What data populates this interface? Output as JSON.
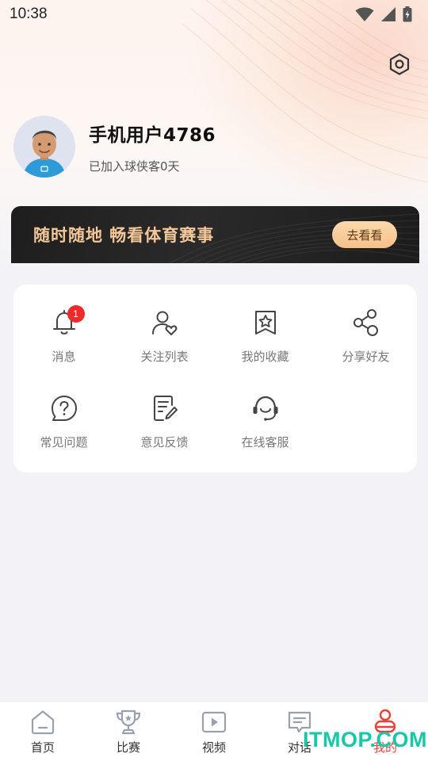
{
  "status_bar": {
    "time": "10:38"
  },
  "profile": {
    "username": "手机用户4786",
    "joined_text": "已加入球侠客0天"
  },
  "banner": {
    "text": "随时随地 畅看体育赛事",
    "button_label": "去看看"
  },
  "menu": {
    "items": [
      {
        "label": "消息",
        "icon": "bell-icon",
        "badge": "1"
      },
      {
        "label": "关注列表",
        "icon": "user-heart-icon"
      },
      {
        "label": "我的收藏",
        "icon": "bookmark-star-icon"
      },
      {
        "label": "分享好友",
        "icon": "share-icon"
      },
      {
        "label": "常见问题",
        "icon": "question-icon"
      },
      {
        "label": "意见反馈",
        "icon": "feedback-edit-icon"
      },
      {
        "label": "在线客服",
        "icon": "headset-icon"
      }
    ]
  },
  "tabbar": {
    "active_tab": "我的",
    "tabs": [
      {
        "label": "首页",
        "icon": "home-icon"
      },
      {
        "label": "比赛",
        "icon": "trophy-icon"
      },
      {
        "label": "视频",
        "icon": "video-play-icon"
      },
      {
        "label": "对话",
        "icon": "chat-icon"
      },
      {
        "label": "我的",
        "icon": "user-icon"
      }
    ]
  },
  "watermark": {
    "text": "ITMOP.COM"
  },
  "colors": {
    "accent_red": "#e8413c",
    "banner_gold": "#f4c898",
    "badge_red": "#f02a2a",
    "watermark_green": "#18c7a6"
  }
}
